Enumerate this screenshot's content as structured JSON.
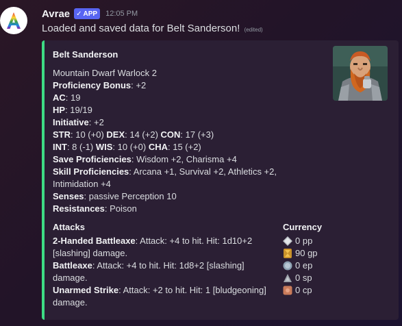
{
  "author": {
    "name": "Avrae",
    "badge": "APP",
    "badge_check": "✓",
    "timestamp": "12:05 PM"
  },
  "message": {
    "text": "Loaded and saved data for Belt Sanderson!",
    "edited": "(edited)"
  },
  "embed": {
    "accent_color": "#3ddc84",
    "title": "Belt Sanderson",
    "race_class": "Mountain Dwarf Warlock 2",
    "stats": {
      "prof_label": "Proficiency Bonus",
      "prof_value": ": +2",
      "ac_label": "AC",
      "ac_value": ": 19",
      "hp_label": "HP",
      "hp_value": ": 19/19",
      "init_label": "Initiative",
      "init_value": ": +2",
      "str_label": "STR",
      "str_value": ": 10 (+0) ",
      "dex_label": "DEX",
      "dex_value": ": 14 (+2) ",
      "con_label": "CON",
      "con_value": ": 17 (+3)",
      "int_label": "INT",
      "int_value": ": 8 (-1) ",
      "wis_label": "WIS",
      "wis_value": ": 10 (+0) ",
      "cha_label": "CHA",
      "cha_value": ": 15 (+2)",
      "saves_label": "Save Proficiencies",
      "saves_value": ": Wisdom +2, Charisma +4",
      "skills_label": "Skill Proficiencies",
      "skills_value": ": Arcana +1, Survival +2, Athletics +2, Intimidation +4",
      "senses_label": "Senses",
      "senses_value": ": passive Perception 10",
      "resist_label": "Resistances",
      "resist_value": ": Poison"
    },
    "attacks": {
      "title": "Attacks",
      "items": [
        {
          "name": "2-Handed Battleaxe",
          "text": ": Attack: +4 to hit. Hit: 1d10+2 [slashing] damage."
        },
        {
          "name": "Battleaxe",
          "text": ": Attack: +4 to hit. Hit: 1d8+2 [slashing] damage."
        },
        {
          "name": "Unarmed Strike",
          "text": ": Attack: +2 to hit. Hit: 1 [bludgeoning] damage."
        }
      ]
    },
    "currency": {
      "title": "Currency",
      "items": [
        {
          "icon": "platinum-coin-icon",
          "amount": "0 pp"
        },
        {
          "icon": "gold-coin-icon",
          "amount": "90 gp"
        },
        {
          "icon": "electrum-coin-icon",
          "amount": "0 ep"
        },
        {
          "icon": "silver-coin-icon",
          "amount": "0 sp"
        },
        {
          "icon": "copper-coin-icon",
          "amount": "0 cp"
        }
      ]
    }
  }
}
